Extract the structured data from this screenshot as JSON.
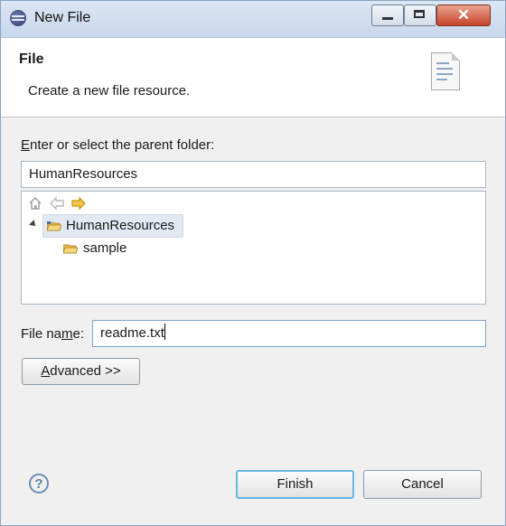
{
  "window": {
    "title": "New File",
    "controls": {
      "minimize": "",
      "maximize": "",
      "close": "✕"
    }
  },
  "header": {
    "title": "File",
    "description": "Create a new file resource."
  },
  "parent_folder": {
    "label_accel": "E",
    "label_rest": "nter or select the parent folder:",
    "value": "HumanResources"
  },
  "tree": {
    "toolbar": [
      "home-icon",
      "back-arrow-icon",
      "forward-arrow-icon"
    ],
    "items": [
      {
        "label": "HumanResources",
        "expanded": true,
        "selected": true
      },
      {
        "label": "sample",
        "expanded": false,
        "selected": false
      }
    ]
  },
  "file_name": {
    "label_pre": "File na",
    "label_accel": "m",
    "label_post": "e:",
    "value": "readme.txt"
  },
  "advanced_button": {
    "accel": "A",
    "rest": "dvanced >>"
  },
  "help_button": {
    "label": "?"
  },
  "finish_button": {
    "label": "Finish"
  },
  "cancel_button": {
    "label": "Cancel"
  },
  "colors": {
    "accent": "#6bb6e6",
    "folder": "#e8b84a",
    "forward_arrow": "#e0a820"
  }
}
